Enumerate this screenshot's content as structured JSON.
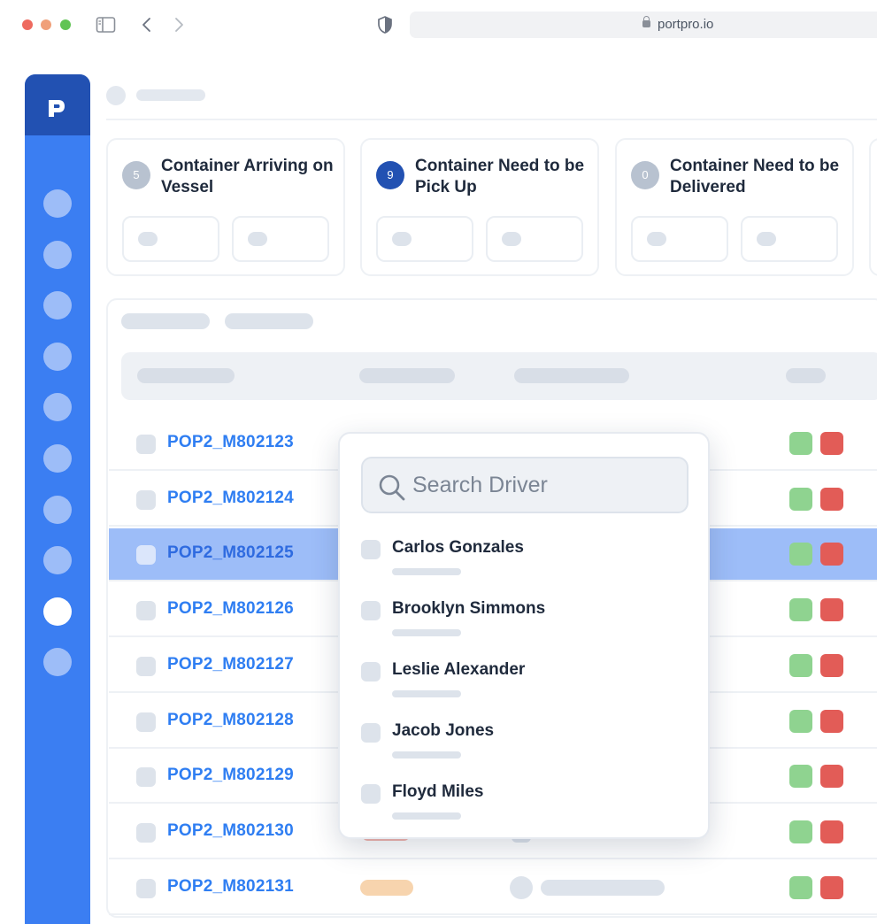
{
  "browser": {
    "url": "portpro.io",
    "traffic_colors": [
      "#ee6a5f",
      "#f5bd4f",
      "#61c454"
    ]
  },
  "sidebar": {
    "logo_letter": "P",
    "active_index": 8,
    "item_count": 10,
    "bg_color": "#3b7ef2",
    "header_color": "#2251b2"
  },
  "cards": [
    {
      "count": "5",
      "title": "Container Arriving on Vessel",
      "badge_color": "#b8c2d0"
    },
    {
      "count": "9",
      "title": "Container Need to be Pick Up",
      "badge_color": "#2251b2"
    },
    {
      "count": "0",
      "title": "Container Need to be Delivered",
      "badge_color": "#b8c2d0"
    }
  ],
  "table": {
    "rows": [
      {
        "id": "POP2_M802123",
        "selected": false
      },
      {
        "id": "POP2_M802124",
        "selected": false
      },
      {
        "id": "POP2_M802125",
        "selected": true
      },
      {
        "id": "POP2_M802126",
        "selected": false
      },
      {
        "id": "POP2_M802127",
        "selected": false
      },
      {
        "id": "POP2_M802128",
        "selected": false
      },
      {
        "id": "POP2_M802129",
        "selected": false
      },
      {
        "id": "POP2_M802130",
        "selected": false
      },
      {
        "id": "POP2_M802131",
        "selected": false
      }
    ],
    "status_colors": {
      "green": "#8fd390",
      "red": "#e25c57"
    }
  },
  "driver_dropdown": {
    "search_placeholder": "Search Driver",
    "search_icon": "search-icon",
    "drivers": [
      {
        "name": "Carlos Gonzales"
      },
      {
        "name": "Brooklyn Simmons"
      },
      {
        "name": "Leslie Alexander"
      },
      {
        "name": "Jacob Jones"
      },
      {
        "name": "Floyd Miles"
      }
    ]
  }
}
